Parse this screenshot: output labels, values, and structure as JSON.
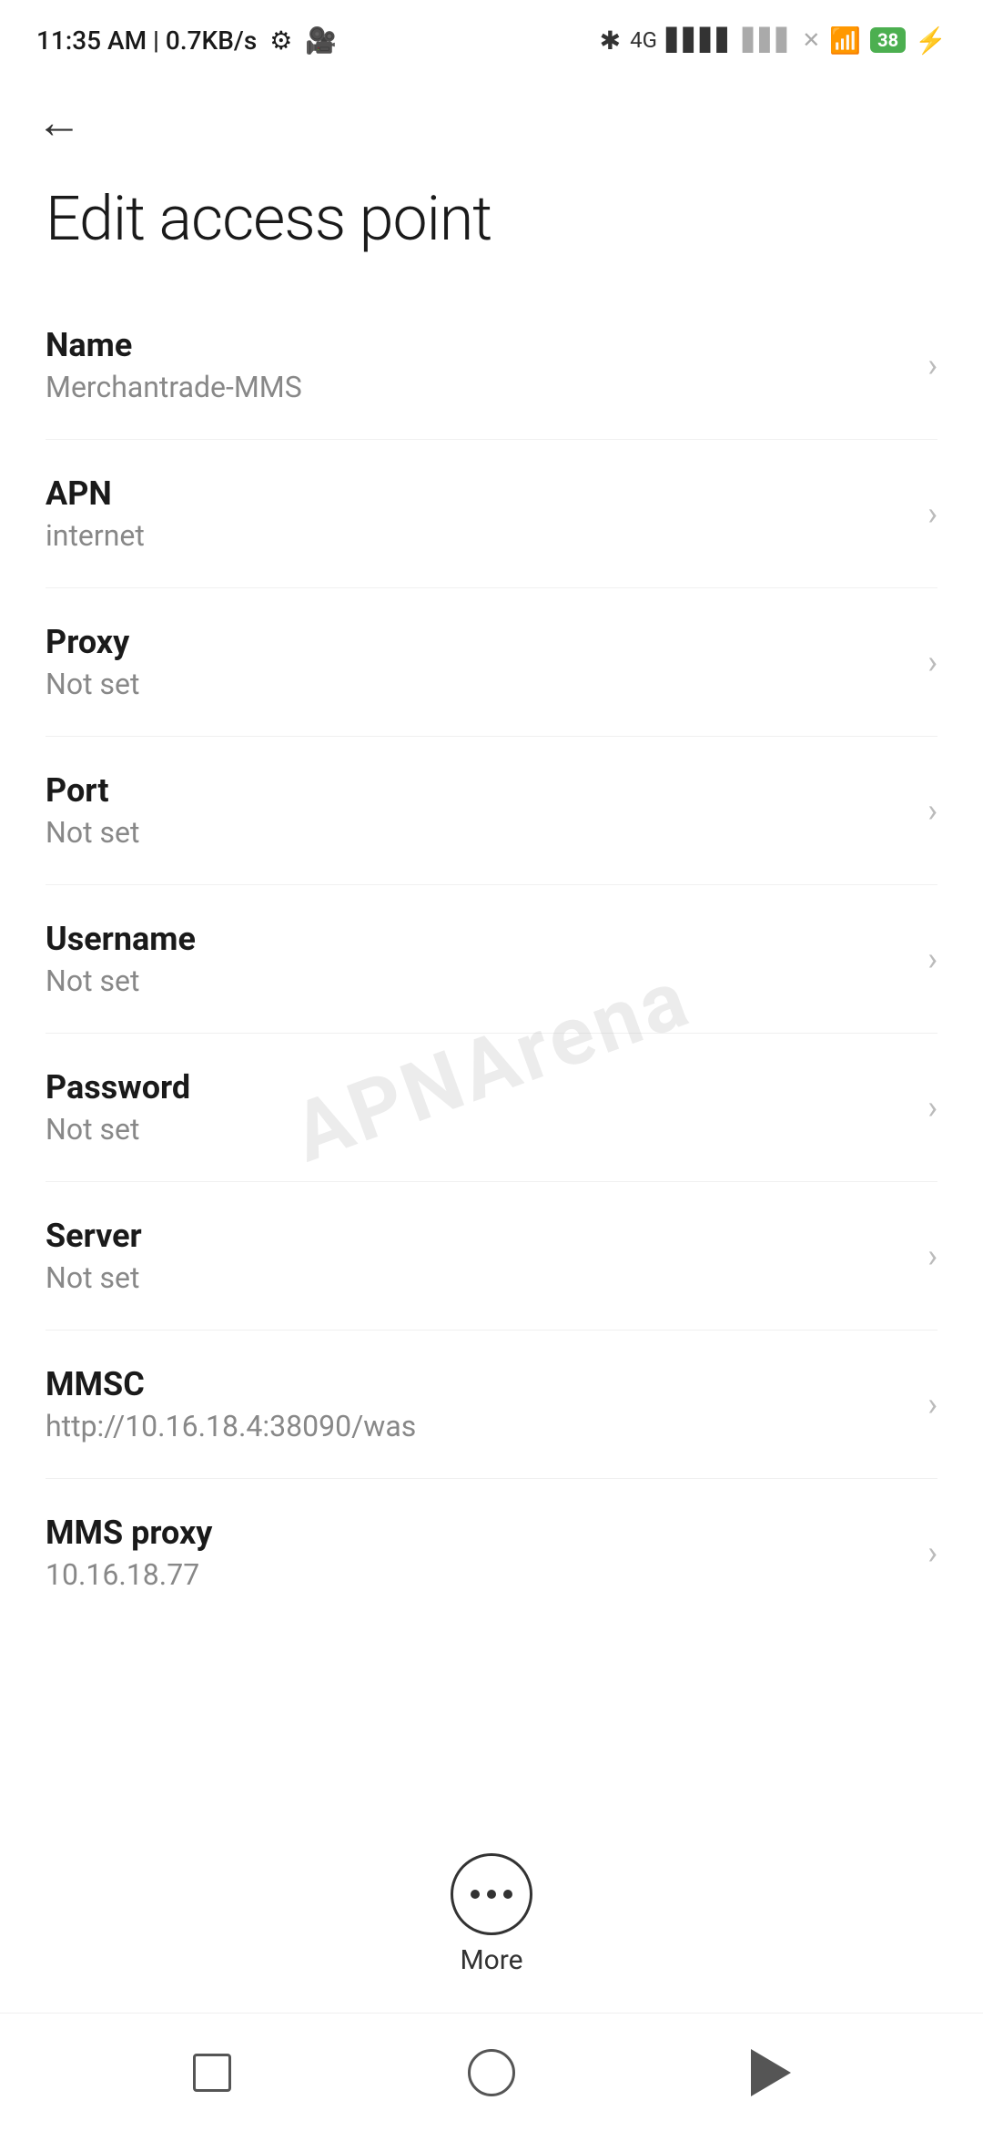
{
  "statusBar": {
    "time": "11:35 AM | 0.7KB/s",
    "battery": "38"
  },
  "navigation": {
    "backLabel": "←"
  },
  "page": {
    "title": "Edit access point"
  },
  "settings": [
    {
      "label": "Name",
      "value": "Merchantrade-MMS"
    },
    {
      "label": "APN",
      "value": "internet"
    },
    {
      "label": "Proxy",
      "value": "Not set"
    },
    {
      "label": "Port",
      "value": "Not set"
    },
    {
      "label": "Username",
      "value": "Not set"
    },
    {
      "label": "Password",
      "value": "Not set"
    },
    {
      "label": "Server",
      "value": "Not set"
    },
    {
      "label": "MMSC",
      "value": "http://10.16.18.4:38090/was"
    },
    {
      "label": "MMS proxy",
      "value": "10.16.18.77"
    }
  ],
  "more": {
    "label": "More"
  },
  "watermark": "APNArena"
}
